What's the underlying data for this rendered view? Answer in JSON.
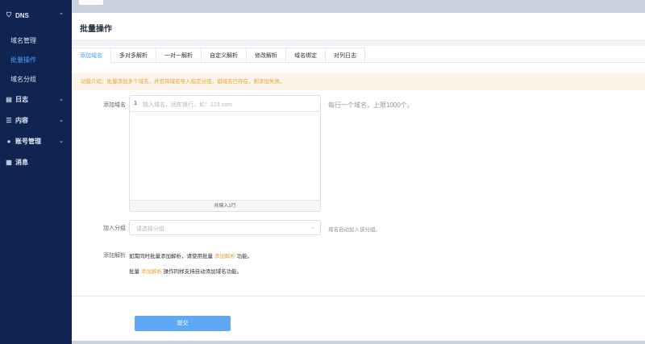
{
  "sidebar": {
    "dns_group": {
      "label": "DNS",
      "icon": "shield-icon"
    },
    "dns_items": [
      {
        "label": "域名管理"
      },
      {
        "label": "批量操作"
      },
      {
        "label": "域名分组"
      }
    ],
    "groups": [
      {
        "label": "日志",
        "icon": "document-icon"
      },
      {
        "label": "内容",
        "icon": "list-icon"
      },
      {
        "label": "账号管理",
        "icon": "user-icon"
      },
      {
        "label": "消息",
        "icon": "message-icon"
      }
    ]
  },
  "main": {
    "page_title": "批量操作",
    "tabs": [
      "添加域名",
      "多对多解析",
      "一对一解析",
      "自定义解析",
      "修改解析",
      "域名绑定",
      "对列日志"
    ],
    "active_tab": "添加域名",
    "notice": "功能介绍：批量添加多个域名，并且将域名导入指定分组，如域名已存在，则添加失败。",
    "add_domain": {
      "label": "添加域名",
      "line_number": "1",
      "placeholder": "输入域名，回车换行，如：123.com",
      "footer": "共输入1行",
      "hint": "每行一个域名，上限1000个。"
    },
    "group": {
      "label": "加入分组",
      "placeholder": "请选择分组",
      "hint": "域名自动加入该分组。"
    },
    "add_resolve": {
      "label": "添加解析",
      "line1_prefix": "如需同时批量添加解析，请使用批量",
      "line1_link": "添加解析",
      "line1_suffix": "功能。",
      "line2_prefix": "批量",
      "line2_link": "添加解析",
      "line2_suffix": "操作同样支持自动添加域名功能。"
    },
    "submit_label": "提交"
  },
  "colors": {
    "sidebar_bg": "#0f2451",
    "accent": "#409eff",
    "warning": "#e6a23c",
    "submit_bg": "#5fa8f5"
  }
}
